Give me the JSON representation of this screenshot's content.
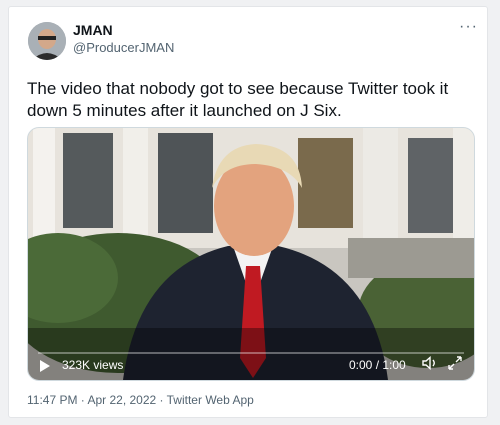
{
  "tweet": {
    "author_name": "JMAN",
    "author_handle": "@ProducerJMAN",
    "more_glyph": "···",
    "text": "The video that nobody got to see because Twitter took it down 5 minutes after it launched on J Six."
  },
  "video": {
    "views": "323K views",
    "time": "0:00 / 1:00",
    "progress": 0
  },
  "footer": {
    "meta": "11:47 PM · Apr 22, 2022 · Twitter Web App"
  },
  "icons": [
    "avatar-photo",
    "more-icon",
    "play-icon",
    "volume-icon",
    "fullscreen-icon"
  ]
}
